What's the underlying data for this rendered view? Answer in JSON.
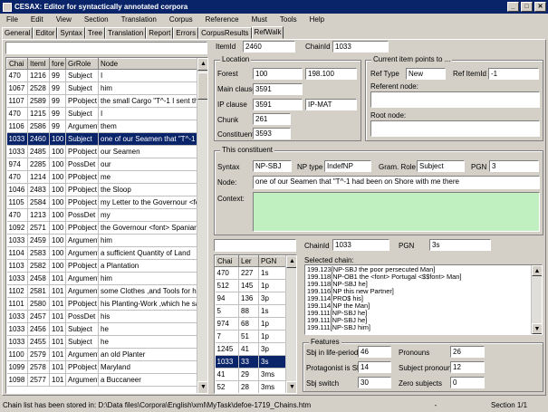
{
  "window": {
    "title": "CESAX: Editor for syntactically annotated corpora"
  },
  "menu": [
    "File",
    "Edit",
    "View",
    "Section",
    "Translation",
    "Corpus",
    "Reference",
    "Must",
    "Tools",
    "Help"
  ],
  "tabs": [
    "General",
    "Editor",
    "Syntax",
    "Tree",
    "Translation",
    "Report",
    "Errors",
    "CorpusResults",
    "RefWalk"
  ],
  "active_tab": "RefWalk",
  "left_table": {
    "search_value": "",
    "headers": [
      "Chai",
      "ItemI",
      "fore",
      "GrRole",
      "Node"
    ],
    "rows": [
      [
        "470",
        "1216",
        "99",
        "Subject",
        "I"
      ],
      [
        "1067",
        "2528",
        "99",
        "Subject",
        "him"
      ],
      [
        "1107",
        "2589",
        "99",
        "PPobject",
        "the small Cargo \"T^-1 I sent them"
      ],
      [
        "470",
        "1215",
        "99",
        "Subject",
        "I"
      ],
      [
        "1106",
        "2586",
        "99",
        "Argument",
        "them"
      ],
      [
        "1033",
        "2460",
        "100",
        "Subject",
        "one of our Seamen that \"T^-1 had been"
      ],
      [
        "1033",
        "2485",
        "100",
        "PPobject",
        "our Seamen"
      ],
      [
        "974",
        "2285",
        "100",
        "PossDet",
        "our"
      ],
      [
        "470",
        "1214",
        "100",
        "PPobject",
        "me"
      ],
      [
        "1046",
        "2483",
        "100",
        "PPobject",
        "the Sloop"
      ],
      [
        "1105",
        "2584",
        "100",
        "PPobject",
        "my Letter to the Governour <font> Span"
      ],
      [
        "470",
        "1213",
        "100",
        "PossDet",
        "my"
      ],
      [
        "1092",
        "2571",
        "100",
        "PPobject",
        "the Governour <font> Spaniard"
      ],
      [
        "1033",
        "2459",
        "100",
        "Argument",
        "him"
      ],
      [
        "1104",
        "2583",
        "100",
        "Argument",
        "a sufficient Quantity of Land"
      ],
      [
        "1103",
        "2582",
        "100",
        "PPobject",
        "a Plantation"
      ],
      [
        "1033",
        "2458",
        "101",
        "Argument",
        "him"
      ],
      [
        "1102",
        "2581",
        "101",
        "Argument",
        "some Clothes ,and Tools for his Planting"
      ],
      [
        "1101",
        "2580",
        "101",
        "PPobject",
        "his Planting-Work ,which he said \"T^-1 I"
      ],
      [
        "1033",
        "2457",
        "101",
        "PossDet",
        "his"
      ],
      [
        "1033",
        "2456",
        "101",
        "Subject",
        "he"
      ],
      [
        "1033",
        "2455",
        "101",
        "Subject",
        "he"
      ],
      [
        "1100",
        "2579",
        "101",
        "Argument",
        "an old Planter"
      ],
      [
        "1099",
        "2578",
        "101",
        "PPobject",
        "Maryland"
      ],
      [
        "1098",
        "2577",
        "101",
        "Argument",
        "a Buccaneer"
      ]
    ],
    "selected_row": 5
  },
  "top_ids": {
    "itemid_label": "ItemId",
    "itemid_value": "2460",
    "chainid_label": "ChainId",
    "chainid_value": "1033"
  },
  "location": {
    "title": "Location",
    "forest_label": "Forest",
    "forest_value": "100",
    "forest_value2": "198.100",
    "main_label": "Main clause",
    "main_value": "3591",
    "ip_label": "IP clause",
    "ip_value": "3591",
    "ip_value2": "IP-MAT",
    "chunk_label": "Chunk",
    "chunk_value": "261",
    "constituent_label": "Constituent",
    "constituent_value": "3593"
  },
  "current_item": {
    "title": "Current item points to ...",
    "reftype_label": "Ref Type",
    "reftype_value": "New",
    "refitemid_label": "Ref ItemId",
    "refitemid_value": "-1",
    "referent_label": "Referent node:",
    "referent_value": "",
    "root_label": "Root node:",
    "root_value": ""
  },
  "constituent": {
    "title": "This constituent",
    "syntax_label": "Syntax",
    "syntax_value": "NP-SBJ",
    "nptype_label": "NP type",
    "nptype_value": "IndefNP",
    "gramrole_label": "Gram. Role",
    "gramrole_value": "Subject",
    "pgn_label": "PGN",
    "pgn_value": "3",
    "node_label": "Node:",
    "node_value": "one of our Seamen that \"T^-1 had been on Shore with me there",
    "context_label": "Context:",
    "context_value": ""
  },
  "chain_table": {
    "search_value": "",
    "headers": [
      "Chai",
      "Ler",
      "PGN"
    ],
    "rows": [
      [
        "470",
        "227",
        "1s"
      ],
      [
        "512",
        "145",
        "1p"
      ],
      [
        "94",
        "136",
        "3p"
      ],
      [
        "5",
        "88",
        "1s"
      ],
      [
        "974",
        "68",
        "1p"
      ],
      [
        "7",
        "51",
        "1p"
      ],
      [
        "1245",
        "41",
        "3p"
      ],
      [
        "1033",
        "33",
        "3s"
      ],
      [
        "41",
        "29",
        "3ms"
      ],
      [
        "52",
        "28",
        "3ms"
      ]
    ],
    "selected_row": 7
  },
  "chain_info": {
    "chainid_label": "ChainId",
    "chainid_value": "1033",
    "pgn_label": "PGN",
    "pgn_value": "3s",
    "selected_label": "Selected chain:"
  },
  "selected_chain": [
    "199.123[NP-SBJ the poor persecuted Man]",
    "199.118[NP-OB1 the <font> Portugal <$$font> Man]",
    "199.118[NP-SBJ he]",
    "199.116[NP this new Partner]",
    "199.114[PRO$ his]",
    "199.114[NP the Man]",
    "199.111[NP-SBJ he]",
    "199.111[NP-SBJ he]",
    "199.111[NP-SBJ him]"
  ],
  "features": {
    "title": "Features",
    "life_label": "Sbj in life-period",
    "life_value": "46",
    "pronouns_label": "Pronouns",
    "pronouns_value": "26",
    "protagonist_label": "Protagonist is Sbj",
    "protagonist_value": "14",
    "subjpron_label": "Subject pronouns",
    "subjpron_value": "12",
    "switch_label": "Sbj switch",
    "switch_value": "30",
    "zero_label": "Zero subjects",
    "zero_value": "0"
  },
  "status": {
    "message": "Chain list has been stored in: D:\\Data files\\Corpora\\English\\xml\\MyTask\\defoe-1719_Chains.htm",
    "dash": "-",
    "section": "Section 1/1"
  },
  "colors": {
    "titlebar": "#0a246a",
    "selection": "#0a246a",
    "context_bg": "#c0f0c0"
  }
}
